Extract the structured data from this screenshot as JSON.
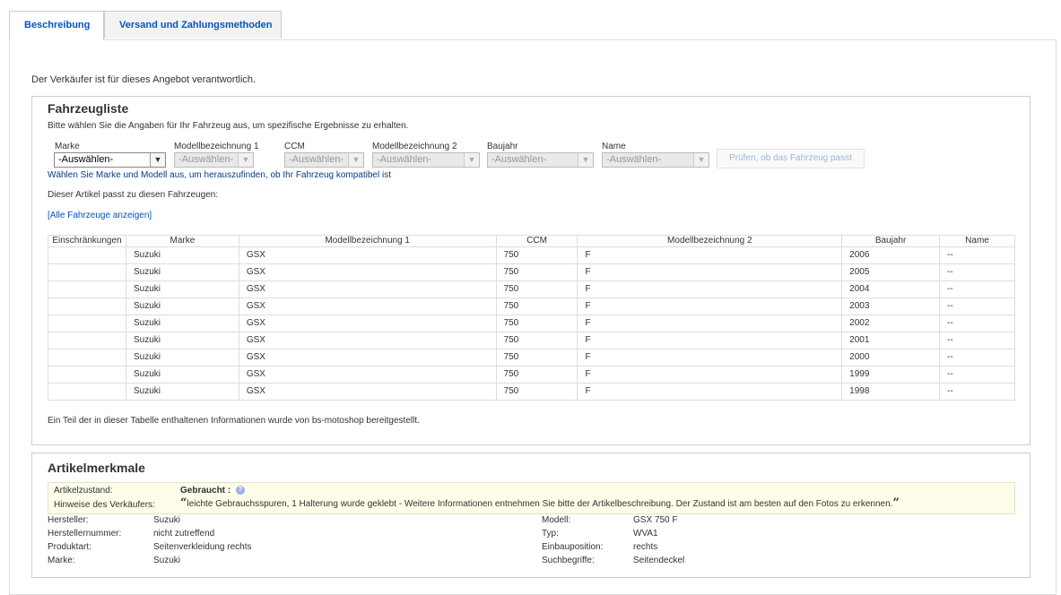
{
  "tabs": {
    "description": "Beschreibung",
    "shipping": "Versand und Zahlungsmethoden"
  },
  "responsibility": "Der Verkäufer ist für dieses Angebot verantwortlich.",
  "vehicle_list": {
    "title": "Fahrzeugliste",
    "intro": "Bitte wählen Sie die Angaben für Ihr Fahrzeug aus, um spezifische Ergebnisse zu erhalten.",
    "selectors": [
      {
        "label": "Marke",
        "value": "-Auswählen-"
      },
      {
        "label": "Modellbezeichnung 1",
        "value": "-Auswählen-"
      },
      {
        "label": "CCM",
        "value": "-Auswählen-"
      },
      {
        "label": "Modellbezeichnung 2",
        "value": "-Auswählen-"
      },
      {
        "label": "Baujahr",
        "value": "-Auswählen-"
      },
      {
        "label": "Name",
        "value": "-Auswählen-"
      }
    ],
    "check_button": "Prüfen, ob das Fahrzeug passt",
    "hint": "Wählen Sie Marke und Modell aus, um herauszufinden, ob Ihr Fahrzeug kompatibel ist",
    "fits_text": "Dieser Artikel passt zu diesen Fahrzeugen:",
    "show_all_link": "[Alle Fahrzeuge anzeigen]",
    "columns": [
      "Einschränkungen",
      "Marke",
      "Modellbezeichnung 1",
      "CCM",
      "Modellbezeichnung 2",
      "Baujahr",
      "Name"
    ],
    "rows": [
      [
        "",
        "Suzuki",
        "GSX",
        "750",
        "F",
        "2006",
        "--"
      ],
      [
        "",
        "Suzuki",
        "GSX",
        "750",
        "F",
        "2005",
        "--"
      ],
      [
        "",
        "Suzuki",
        "GSX",
        "750",
        "F",
        "2004",
        "--"
      ],
      [
        "",
        "Suzuki",
        "GSX",
        "750",
        "F",
        "2003",
        "--"
      ],
      [
        "",
        "Suzuki",
        "GSX",
        "750",
        "F",
        "2002",
        "--"
      ],
      [
        "",
        "Suzuki",
        "GSX",
        "750",
        "F",
        "2001",
        "--"
      ],
      [
        "",
        "Suzuki",
        "GSX",
        "750",
        "F",
        "2000",
        "--"
      ],
      [
        "",
        "Suzuki",
        "GSX",
        "750",
        "F",
        "1999",
        "--"
      ],
      [
        "",
        "Suzuki",
        "GSX",
        "750",
        "F",
        "1998",
        "--"
      ]
    ],
    "source_note": "Ein Teil der in dieser Tabelle enthaltenen Informationen wurde von bs-motoshop bereitgestellt."
  },
  "item_specs": {
    "title": "Artikelmerkmale",
    "condition_label": "Artikelzustand:",
    "condition_value": "Gebraucht :",
    "seller_notes_label": "Hinweise des Verkäufers:",
    "seller_notes": "leichte Gebrauchsspuren, 1 Halterung wurde geklebt - Weitere Informationen entnehmen Sie bitte der Artikelbeschreibung. Der Zustand ist am besten auf den Fotos zu erkennen.",
    "left": [
      {
        "label": "Hersteller:",
        "value": "Suzuki"
      },
      {
        "label": "Herstellernummer:",
        "value": "nicht zutreffend"
      },
      {
        "label": "Produktart:",
        "value": "Seitenverkleidung rechts"
      },
      {
        "label": "Marke:",
        "value": "Suzuki"
      }
    ],
    "right": [
      {
        "label": "Modell:",
        "value": "GSX 750 F"
      },
      {
        "label": "Typ:",
        "value": "WVA1"
      },
      {
        "label": "Einbauposition:",
        "value": "rechts"
      },
      {
        "label": "Suchbegriffe:",
        "value": "Seitendeckel"
      }
    ]
  }
}
